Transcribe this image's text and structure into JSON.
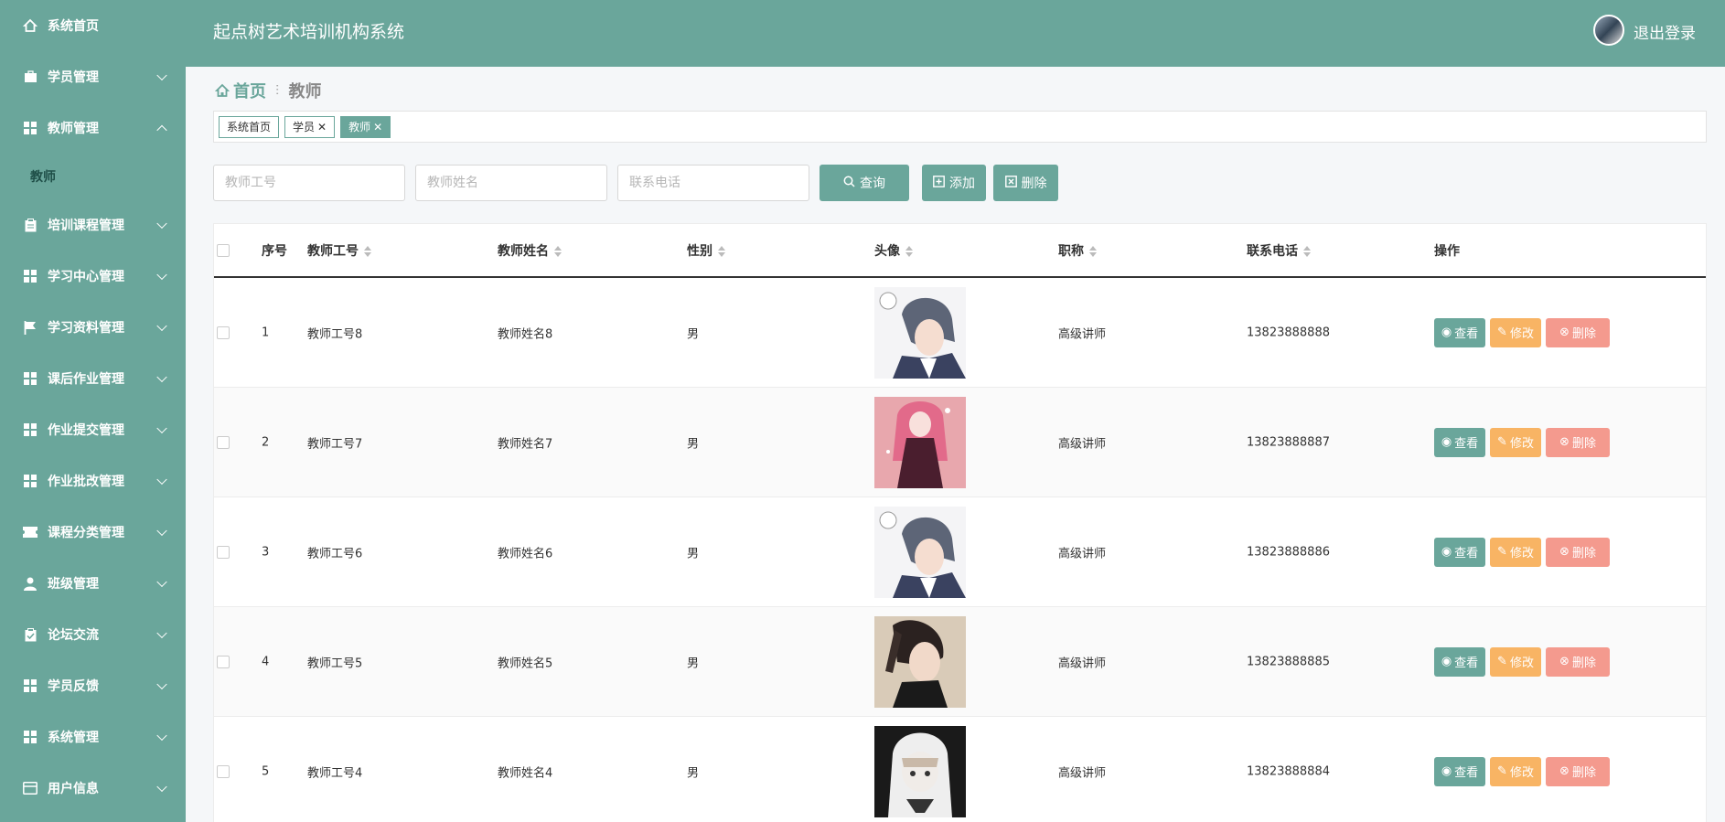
{
  "header": {
    "title": "起点树艺术培训机构系统",
    "logout": "退出登录"
  },
  "sidebar": {
    "items": [
      {
        "label": "系统首页",
        "icon": "home-icon",
        "expanded": null
      },
      {
        "label": "学员管理",
        "icon": "case-icon",
        "expanded": false
      },
      {
        "label": "教师管理",
        "icon": "grid-icon",
        "expanded": true
      },
      {
        "label": "培训课程管理",
        "icon": "clipboard-icon",
        "expanded": false
      },
      {
        "label": "学习中心管理",
        "icon": "grid-icon",
        "expanded": false
      },
      {
        "label": "学习资料管理",
        "icon": "flag-icon",
        "expanded": false
      },
      {
        "label": "课后作业管理",
        "icon": "grid-icon",
        "expanded": false
      },
      {
        "label": "作业提交管理",
        "icon": "grid-icon",
        "expanded": false
      },
      {
        "label": "作业批改管理",
        "icon": "grid-icon",
        "expanded": false
      },
      {
        "label": "课程分类管理",
        "icon": "ticket-icon",
        "expanded": false
      },
      {
        "label": "班级管理",
        "icon": "user-icon",
        "expanded": false
      },
      {
        "label": "论坛交流",
        "icon": "clipboard-check-icon",
        "expanded": false
      },
      {
        "label": "学员反馈",
        "icon": "grid-icon",
        "expanded": false
      },
      {
        "label": "系统管理",
        "icon": "grid-icon",
        "expanded": false
      },
      {
        "label": "用户信息",
        "icon": "id-card-icon",
        "expanded": false
      }
    ],
    "sub": {
      "label": "教师"
    }
  },
  "breadcrumb": {
    "home": "首页",
    "separator": "ⵗ",
    "current": "教师"
  },
  "tags": [
    {
      "label": "系统首页",
      "closable": false,
      "active": false
    },
    {
      "label": "学员",
      "closable": true,
      "active": false
    },
    {
      "label": "教师",
      "closable": true,
      "active": true
    }
  ],
  "search": {
    "teacher_id_placeholder": "教师工号",
    "teacher_name_placeholder": "教师姓名",
    "phone_placeholder": "联系电话",
    "query_label": "查询",
    "add_label": "添加",
    "delete_label": "删除"
  },
  "table": {
    "columns": [
      "序号",
      "教师工号",
      "教师姓名",
      "性别",
      "头像",
      "职称",
      "联系电话",
      "操作"
    ],
    "actions": {
      "view": "查看",
      "edit": "修改",
      "delete": "删除"
    },
    "rows": [
      {
        "no": "1",
        "id": "教师工号8",
        "name": "教师姓名8",
        "gender": "男",
        "title": "高级讲师",
        "phone": "13823888888",
        "avatar": "anime-boy"
      },
      {
        "no": "2",
        "id": "教师工号7",
        "name": "教师姓名7",
        "gender": "男",
        "title": "高级讲师",
        "phone": "13823888887",
        "avatar": "anime-girl-pink"
      },
      {
        "no": "3",
        "id": "教师工号6",
        "name": "教师姓名6",
        "gender": "男",
        "title": "高级讲师",
        "phone": "13823888886",
        "avatar": "anime-boy"
      },
      {
        "no": "4",
        "id": "教师工号5",
        "name": "教师姓名5",
        "gender": "男",
        "title": "高级讲师",
        "phone": "13823888885",
        "avatar": "braid-girl"
      },
      {
        "no": "5",
        "id": "教师工号4",
        "name": "教师姓名4",
        "gender": "男",
        "title": "高级讲师",
        "phone": "13823888884",
        "avatar": "bw-girl"
      }
    ]
  },
  "colors": {
    "primary": "#6aa69b",
    "edit": "#f8b464",
    "delete": "#f49a8e"
  }
}
